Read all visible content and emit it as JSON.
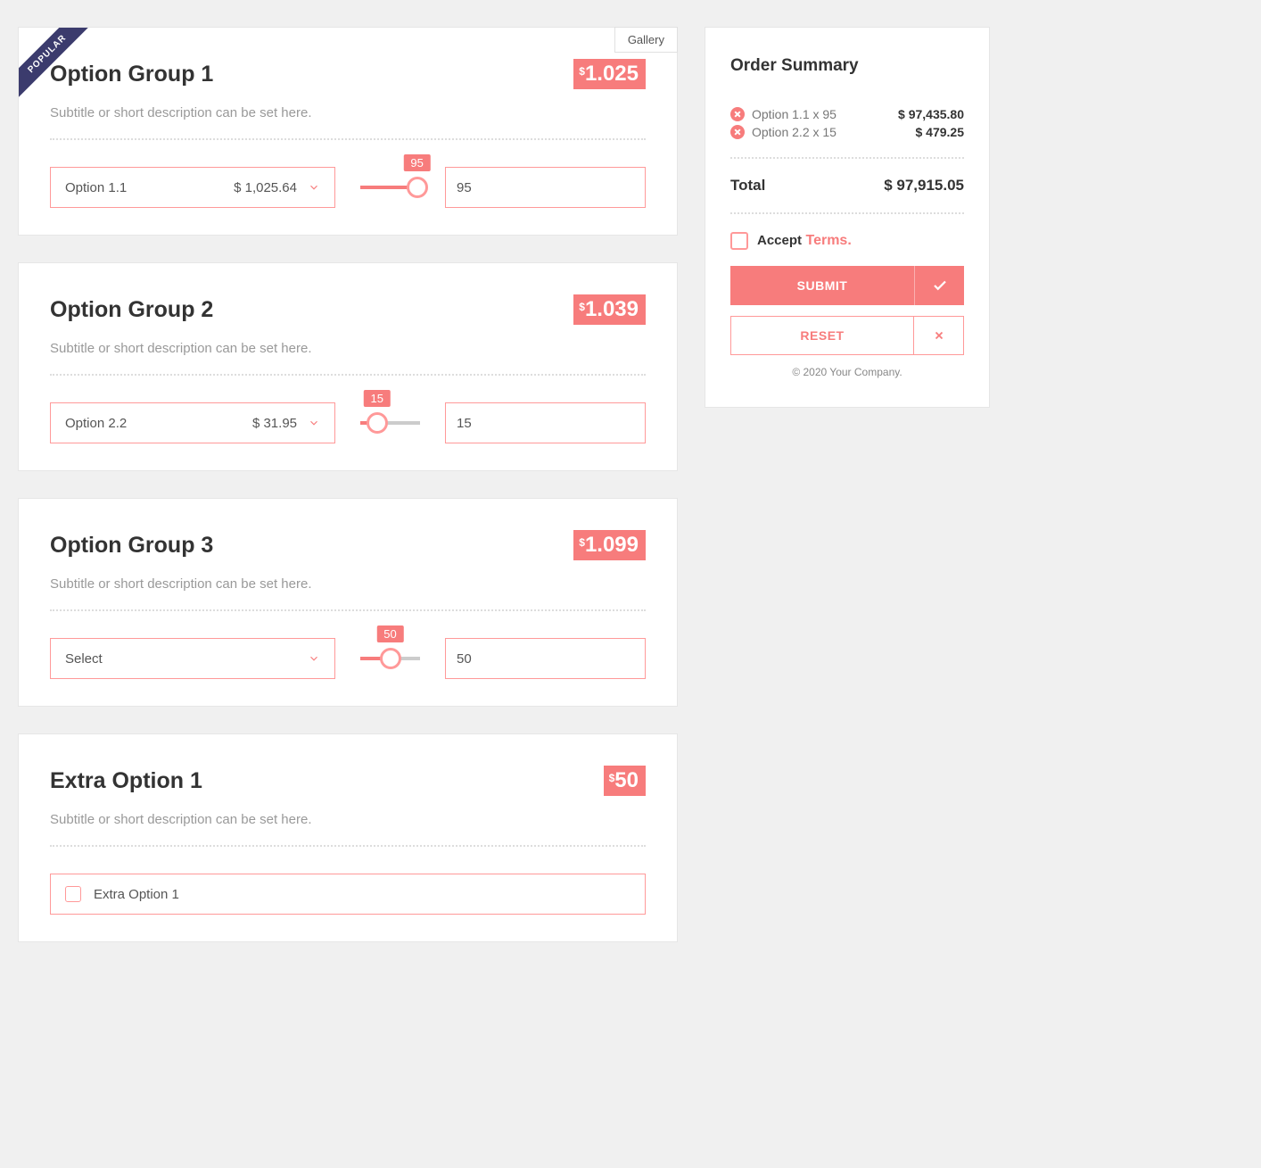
{
  "groups": [
    {
      "ribbon": "POPULAR",
      "gallery": "Gallery",
      "title": "Option Group 1",
      "price_tag": "1.025",
      "subtitle": "Subtitle or short description can be set here.",
      "select_label": "Option 1.1",
      "select_price": "$ 1,025.64",
      "slider_value": 95,
      "qty": "95"
    },
    {
      "title": "Option Group 2",
      "price_tag": "1.039",
      "subtitle": "Subtitle or short description can be set here.",
      "select_label": "Option 2.2",
      "select_price": "$ 31.95",
      "slider_value": 28,
      "slider_tooltip": "15",
      "qty": "15"
    },
    {
      "title": "Option Group 3",
      "price_tag": "1.099",
      "subtitle": "Subtitle or short description can be set here.",
      "select_label": "Select",
      "select_price": "",
      "slider_value": 50,
      "qty": "50"
    }
  ],
  "extra": {
    "title": "Extra Option 1",
    "price_tag": "50",
    "subtitle": "Subtitle or short description can be set here.",
    "option_label": "Extra Option 1"
  },
  "summary": {
    "title": "Order Summary",
    "items": [
      {
        "label": "Option 1.1 x 95",
        "price": "$ 97,435.80"
      },
      {
        "label": "Option 2.2 x 15",
        "price": "$ 479.25"
      }
    ],
    "total_label": "Total",
    "total_value": "$ 97,915.05",
    "accept_label": "Accept",
    "terms_label": "Terms",
    "submit_label": "SUBMIT",
    "reset_label": "RESET",
    "copyright": "© 2020 Your Company."
  }
}
